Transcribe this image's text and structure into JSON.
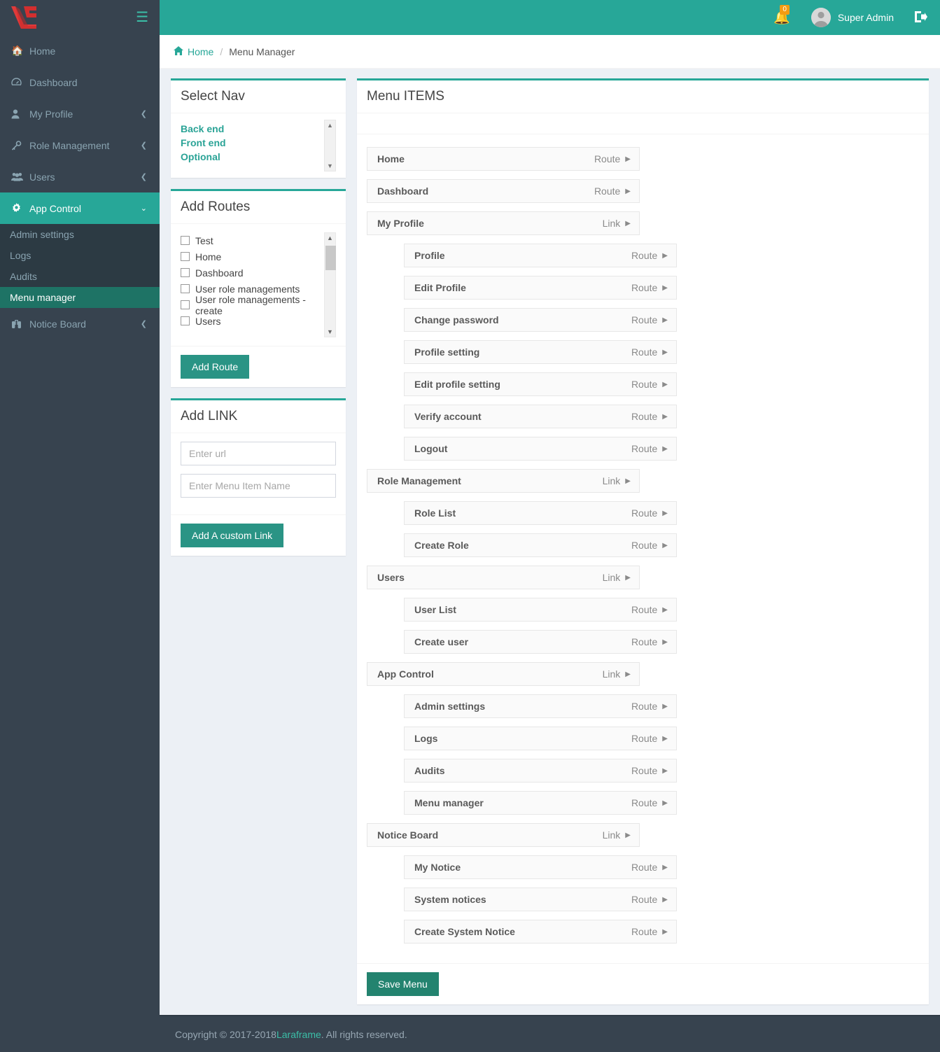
{
  "brand": {
    "logo_icon": "laravel-logo",
    "hamburger_icon": "hamburger-icon"
  },
  "sidebar": {
    "items": [
      {
        "label": "Home",
        "icon": "home-icon",
        "has_caret": false,
        "active": false
      },
      {
        "label": "Dashboard",
        "icon": "dashboard-icon",
        "has_caret": false,
        "active": false
      },
      {
        "label": "My Profile",
        "icon": "user-icon",
        "has_caret": true,
        "active": false
      },
      {
        "label": "Role Management",
        "icon": "key-icon",
        "has_caret": true,
        "active": false
      },
      {
        "label": "Users",
        "icon": "users-icon",
        "has_caret": true,
        "active": false
      },
      {
        "label": "App Control",
        "icon": "gear-icon",
        "has_caret": true,
        "active": true
      },
      {
        "label": "Notice Board",
        "icon": "binoculars-icon",
        "has_caret": true,
        "active": false
      }
    ],
    "submenu": [
      {
        "label": "Admin settings",
        "active": false
      },
      {
        "label": "Logs",
        "active": false
      },
      {
        "label": "Audits",
        "active": false
      },
      {
        "label": "Menu manager",
        "active": true
      }
    ]
  },
  "topbar": {
    "bell_icon": "bell-icon",
    "notification_count": "0",
    "avatar_icon": "avatar-icon",
    "username": "Super Admin",
    "logout_icon": "logout-icon"
  },
  "breadcrumb": {
    "home_icon": "home-icon",
    "home": "Home",
    "separator": "/",
    "current": "Menu Manager"
  },
  "select_nav": {
    "title": "Select Nav",
    "options": [
      "Back end",
      "Front end",
      "Optional"
    ],
    "scroll_up_icon": "chevron-up-icon",
    "scroll_down_icon": "chevron-down-icon"
  },
  "add_routes": {
    "title": "Add Routes",
    "routes": [
      "Test",
      "Home",
      "Dashboard",
      "User role managements",
      "User role managements - create",
      "Users"
    ],
    "button_label": "Add Route",
    "scroll_up_icon": "chevron-up-icon",
    "scroll_down_icon": "chevron-down-icon"
  },
  "add_link": {
    "title": "Add LINK",
    "url_value": "",
    "url_placeholder": "Enter url",
    "name_value": "",
    "name_placeholder": "Enter Menu Item Name",
    "button_label": "Add A custom Link"
  },
  "menu_items": {
    "title": "Menu ITEMS",
    "save_label": "Save Menu",
    "arrow_icon": "triangle-right-icon",
    "items": [
      {
        "label": "Home",
        "type": "Route",
        "level": 0
      },
      {
        "label": "Dashboard",
        "type": "Route",
        "level": 0
      },
      {
        "label": "My Profile",
        "type": "Link",
        "level": 0
      },
      {
        "label": "Profile",
        "type": "Route",
        "level": 1
      },
      {
        "label": "Edit Profile",
        "type": "Route",
        "level": 1
      },
      {
        "label": "Change password",
        "type": "Route",
        "level": 1
      },
      {
        "label": "Profile setting",
        "type": "Route",
        "level": 1
      },
      {
        "label": "Edit profile setting",
        "type": "Route",
        "level": 1
      },
      {
        "label": "Verify account",
        "type": "Route",
        "level": 1
      },
      {
        "label": "Logout",
        "type": "Route",
        "level": 1
      },
      {
        "label": "Role Management",
        "type": "Link",
        "level": 0
      },
      {
        "label": "Role List",
        "type": "Route",
        "level": 1
      },
      {
        "label": "Create Role",
        "type": "Route",
        "level": 1
      },
      {
        "label": "Users",
        "type": "Link",
        "level": 0
      },
      {
        "label": "User List",
        "type": "Route",
        "level": 1
      },
      {
        "label": "Create user",
        "type": "Route",
        "level": 1
      },
      {
        "label": "App Control",
        "type": "Link",
        "level": 0
      },
      {
        "label": "Admin settings",
        "type": "Route",
        "level": 1
      },
      {
        "label": "Logs",
        "type": "Route",
        "level": 1
      },
      {
        "label": "Audits",
        "type": "Route",
        "level": 1
      },
      {
        "label": "Menu manager",
        "type": "Route",
        "level": 1
      },
      {
        "label": "Notice Board",
        "type": "Link",
        "level": 0
      },
      {
        "label": "My Notice",
        "type": "Route",
        "level": 1
      },
      {
        "label": "System notices",
        "type": "Route",
        "level": 1
      },
      {
        "label": "Create System Notice",
        "type": "Route",
        "level": 1
      }
    ]
  },
  "footer": {
    "prefix": "Copyright © 2017-2018 ",
    "link": "Laraframe",
    "suffix": ". All rights reserved."
  },
  "colors": {
    "accent": "#27a798",
    "sidebar": "#37434f",
    "submenu": "#2c3a43",
    "active_sub": "#1e7365",
    "badge": "#f39c12",
    "logo_red": "#e03a3a"
  }
}
